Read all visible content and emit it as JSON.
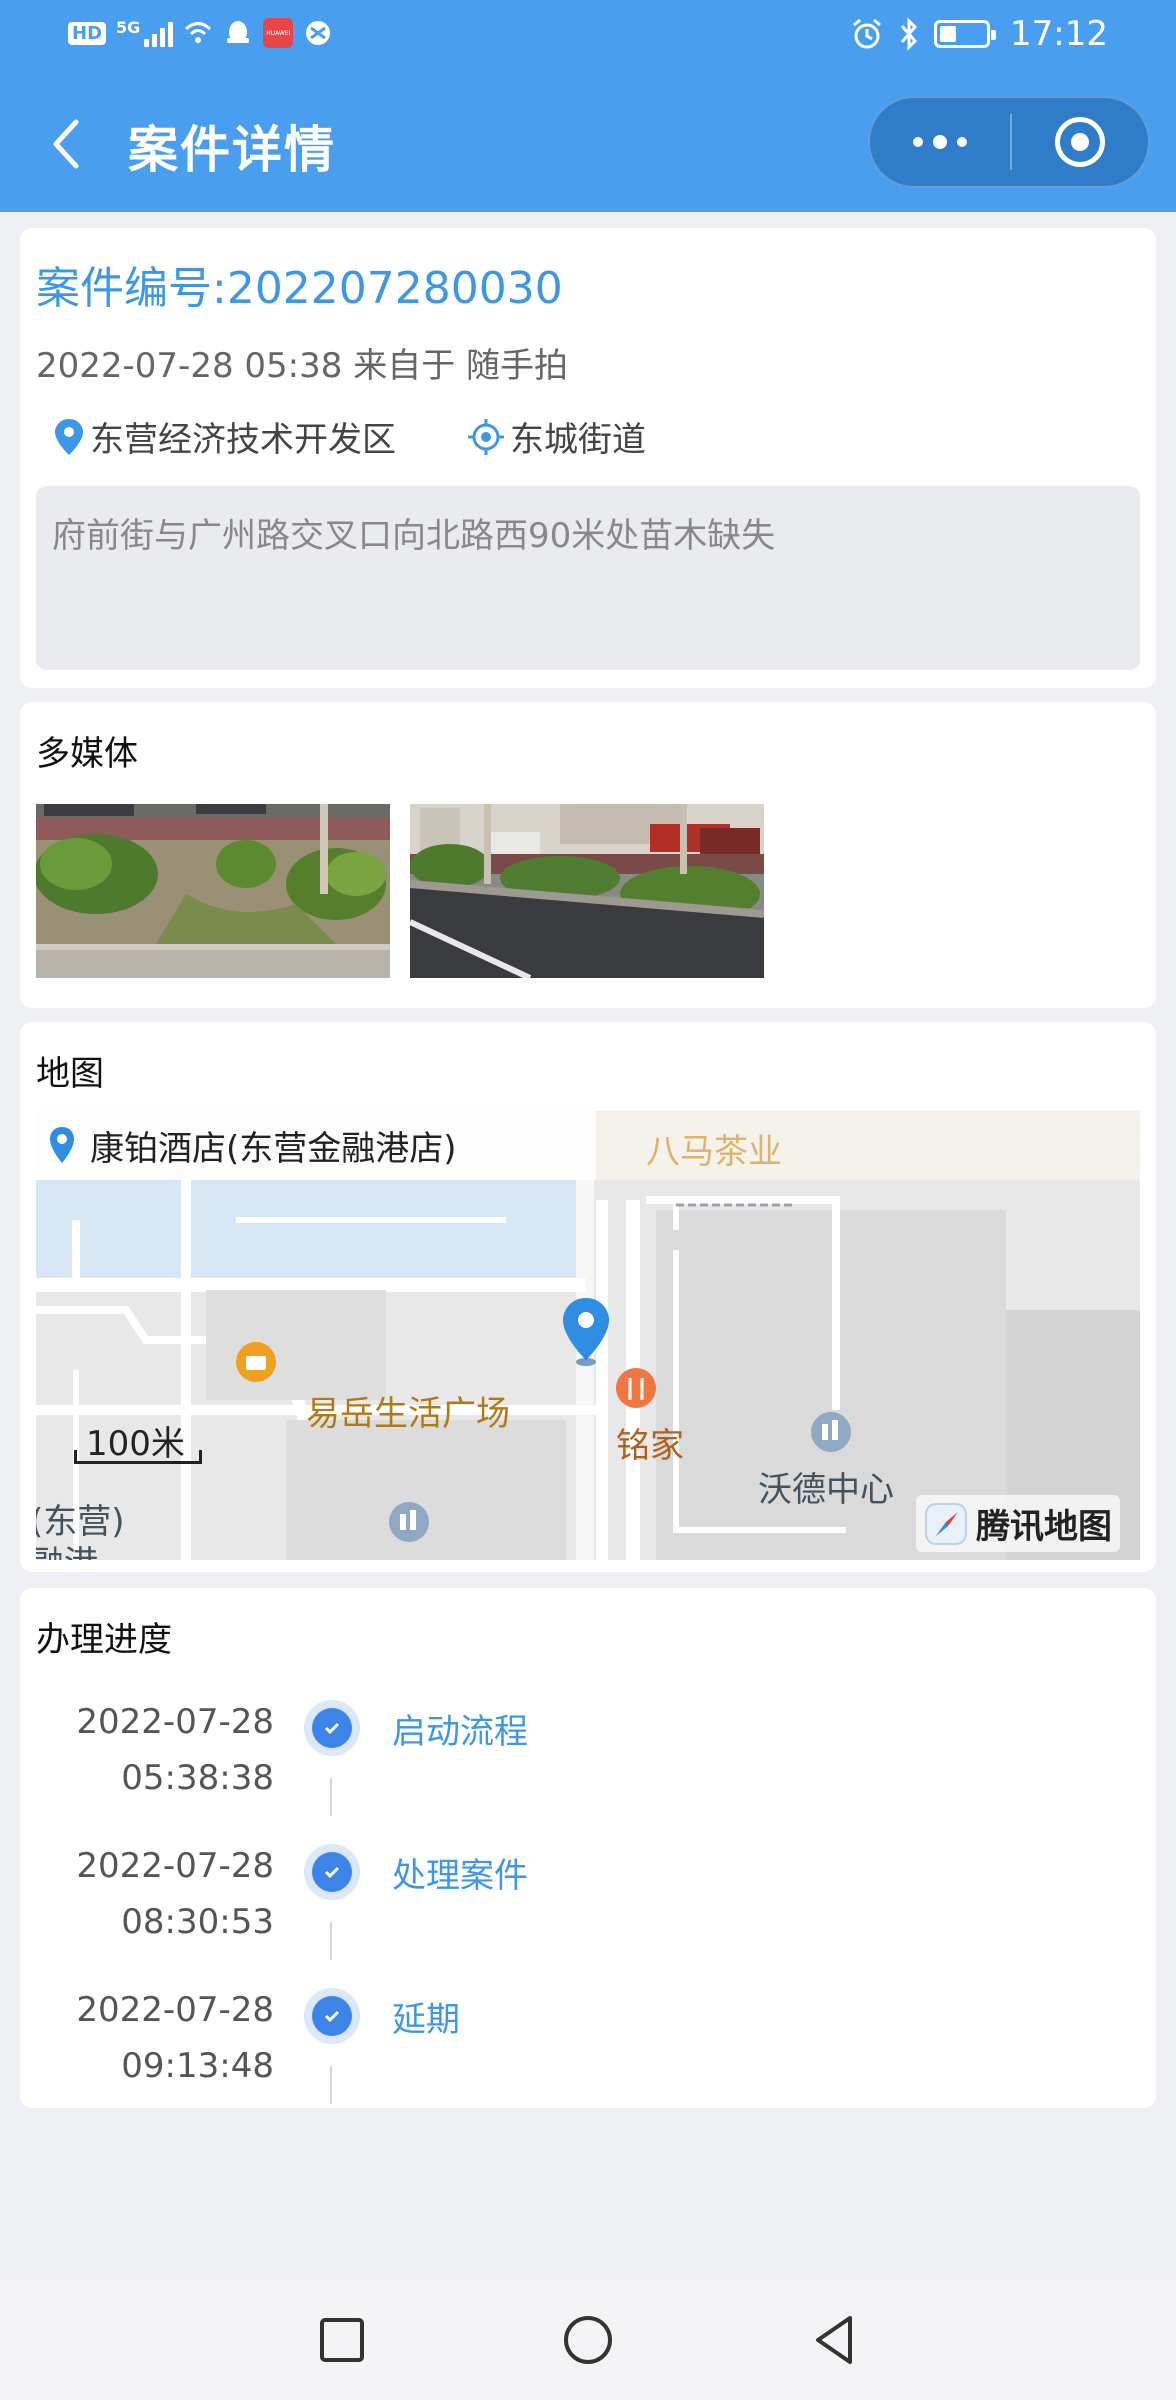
{
  "status_bar": {
    "hd": "HD",
    "network": "5G",
    "time": "17:12",
    "app_badge": "HUAWEI"
  },
  "header": {
    "title": "案件详情"
  },
  "case": {
    "number": "案件编号:202207280030",
    "meta": "2022-07-28 05:38 来自于 随手拍",
    "district": "东营经济技术开发区",
    "street": "东城街道",
    "description": "府前街与广州路交叉口向北路西90米处苗木缺失"
  },
  "media": {
    "title": "多媒体"
  },
  "map": {
    "title": "地图",
    "place_name": "康铂酒店(东营金融港店)",
    "poi_labels": {
      "tea": "八马茶业",
      "plaza": "易岳生活广场",
      "mingjia": "铭家",
      "center": "沃德中心",
      "dongying": "(东营)",
      "rong_gang": "融港"
    },
    "scale": "100米",
    "provider": "腾讯地图"
  },
  "progress": {
    "title": "办理进度",
    "steps": [
      {
        "date": "2022-07-28",
        "time": "05:38:38",
        "label": "启动流程"
      },
      {
        "date": "2022-07-28",
        "time": "08:30:53",
        "label": "处理案件"
      },
      {
        "date": "2022-07-28",
        "time": "09:13:48",
        "label": "延期"
      }
    ]
  },
  "colors": {
    "primary": "#4a9ef0",
    "link": "#3e97e6",
    "step_dot": "#3d84e8",
    "poi_orange": "#c98a1a",
    "background": "#eff0f4"
  }
}
